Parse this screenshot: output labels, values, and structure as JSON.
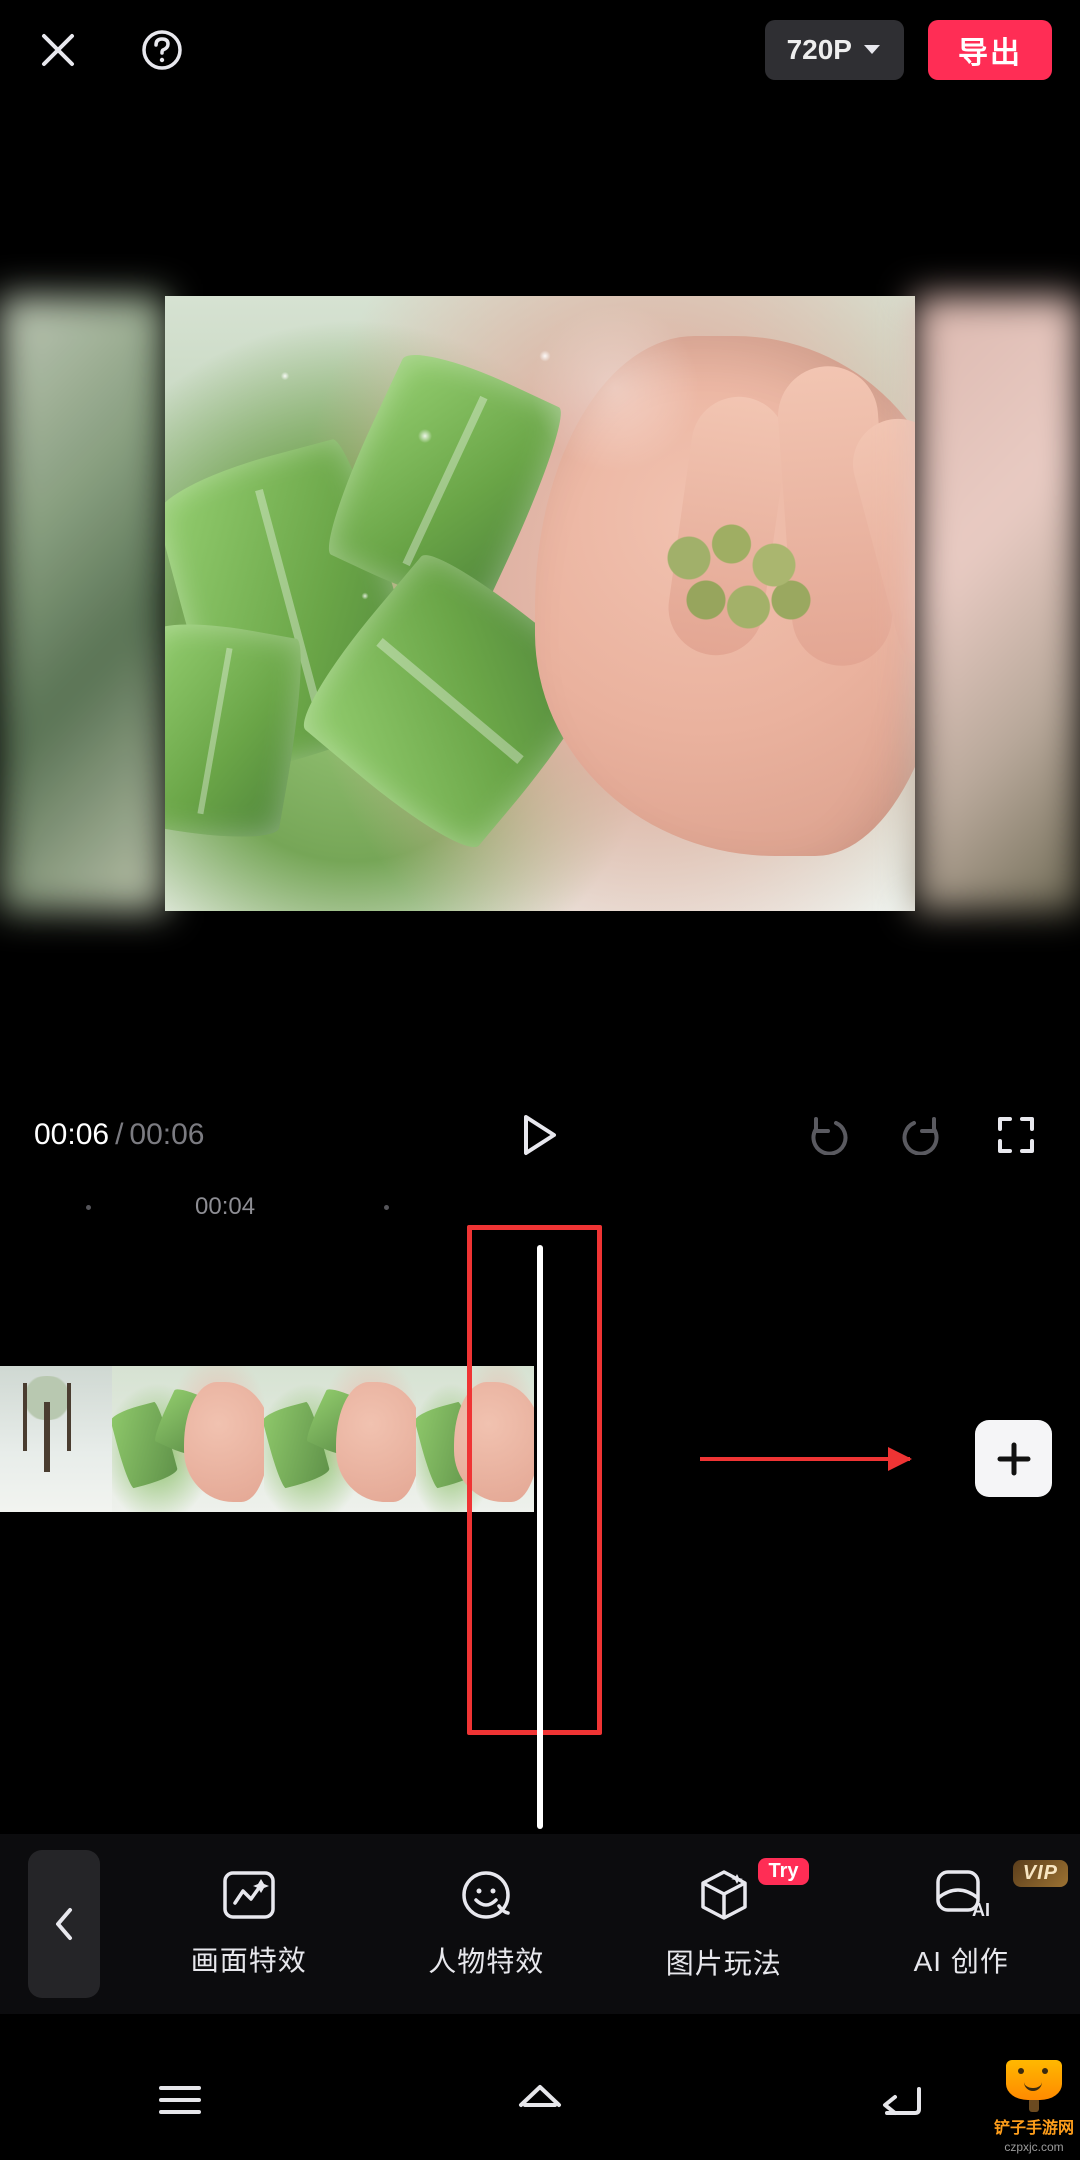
{
  "header": {
    "resolution_label": "720P",
    "export_label": "导出"
  },
  "playback": {
    "current_time": "00:06",
    "total_time": "00:06"
  },
  "ruler": {
    "marker_label": "00:04"
  },
  "effects": {
    "items": [
      {
        "label": "画面特效"
      },
      {
        "label": "人物特效"
      },
      {
        "label": "图片玩法",
        "badge": "Try"
      },
      {
        "label": "AI 创作",
        "badge": "VIP"
      }
    ]
  },
  "watermark": {
    "line1": "铲子手游网",
    "line2": "czpxjc.com"
  }
}
